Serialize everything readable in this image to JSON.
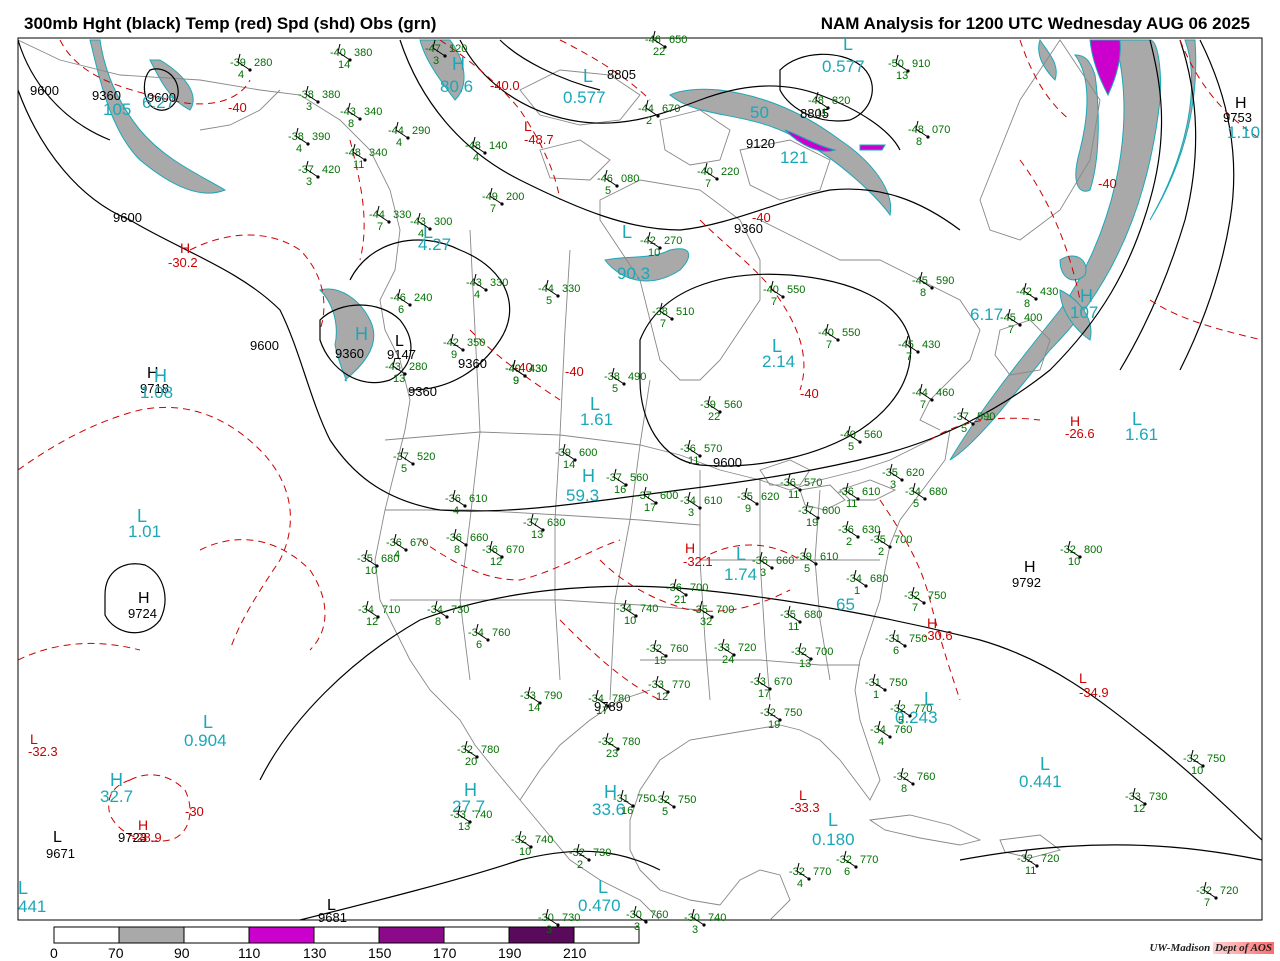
{
  "header": {
    "left_title": "300mb Hght (black) Temp (red) Spd (shd) Obs (grn)",
    "right_title": "NAM Analysis for 1200 UTC Wednesday  AUG 06 2025"
  },
  "colors": {
    "height": "#000000",
    "temp": "#cc0000",
    "speed_label": "#1aa8b8",
    "obs": "#007000",
    "border": "#888888",
    "shade_70_90": "#a9a9a9",
    "shade_110_130": "#cc00cc",
    "shade_150_170": "#8a0a8a",
    "shade_190_210": "#5a0a5a"
  },
  "legend": {
    "ticks": [
      "0",
      "70",
      "90",
      "110",
      "130",
      "150",
      "170",
      "190",
      "210"
    ]
  },
  "credit": {
    "left": "UW-Madison",
    "right": "Dept of AOS"
  },
  "height_labels": [
    "9600",
    "9360",
    "9600",
    "9600",
    "9360",
    "9147",
    "9360",
    "9360",
    "9600",
    "9792",
    "9724",
    "9718",
    "9671",
    "9723",
    "9681",
    "9789",
    "9753",
    "8805",
    "8805",
    "9120",
    "9360",
    "9600"
  ],
  "height_centers": [
    {
      "letter": "H",
      "value": "9718"
    },
    {
      "letter": "H",
      "value": "9724"
    },
    {
      "letter": "H",
      "value": "9792"
    },
    {
      "letter": "H",
      "value": "9753"
    },
    {
      "letter": "L",
      "value": "9671"
    },
    {
      "letter": "L",
      "value": "9681"
    },
    {
      "letter": "L",
      "value": "9147"
    }
  ],
  "temp_labels": [
    "-30.2",
    "-40",
    "-40.0",
    "-40",
    "-40",
    "-48.7",
    "-40",
    "-40",
    "-32.1",
    "-26.6",
    "-30.6",
    "-34.9",
    "-32.3",
    "-30",
    "-33.3",
    "-28.9",
    "-40"
  ],
  "speed_labels": [
    "105",
    "6.27",
    "80.6",
    "0.577",
    "0.577",
    "4.27",
    "90.3",
    "2.14",
    "1.61",
    "1.61",
    "59.3",
    "1.01",
    "0.904",
    "32.7",
    "27.7",
    "33.6",
    "0.180",
    "0.470",
    "0.441",
    "0.243",
    "1.10",
    "107",
    "6.17",
    "1.08",
    "65",
    "1.74",
    "441",
    "121",
    "50"
  ],
  "station_obs": [
    {
      "t": "-39",
      "h": "280",
      "s": "4"
    },
    {
      "t": "-40",
      "h": "380",
      "s": "14"
    },
    {
      "t": "-47",
      "h": "120",
      "s": "3"
    },
    {
      "t": "-38",
      "h": "380",
      "s": "3"
    },
    {
      "t": "-43",
      "h": "340",
      "s": "8"
    },
    {
      "t": "-38",
      "h": "390",
      "s": "4"
    },
    {
      "t": "-44",
      "h": "290",
      "s": "4"
    },
    {
      "t": "-48",
      "h": "340",
      "s": "11"
    },
    {
      "t": "-37",
      "h": "420",
      "s": "3"
    },
    {
      "t": "-48",
      "h": "140",
      "s": "4"
    },
    {
      "t": "-46",
      "h": "080",
      "s": "5"
    },
    {
      "t": "-49",
      "h": "200",
      "s": "7"
    },
    {
      "t": "-44",
      "h": "670",
      "s": "2"
    },
    {
      "t": "-46",
      "h": "650",
      "s": "22"
    },
    {
      "t": "-40",
      "h": "220",
      "s": "7"
    },
    {
      "t": "-50",
      "h": "910",
      "s": "13"
    },
    {
      "t": "-48",
      "h": "820",
      "s": "11"
    },
    {
      "t": "-48",
      "h": "070",
      "s": "8"
    },
    {
      "t": "-44",
      "h": "330",
      "s": "7"
    },
    {
      "t": "-43",
      "h": "300",
      "s": "4"
    },
    {
      "t": "-42",
      "h": "270",
      "s": "10"
    },
    {
      "t": "-46",
      "h": "240",
      "s": "6"
    },
    {
      "t": "-43",
      "h": "330",
      "s": "4"
    },
    {
      "t": "-44",
      "h": "330",
      "s": "5"
    },
    {
      "t": "-42",
      "h": "350",
      "s": "9"
    },
    {
      "t": "-40",
      "h": "430",
      "s": "9"
    },
    {
      "t": "-43",
      "h": "280",
      "s": "13"
    },
    {
      "t": "-38",
      "h": "510",
      "s": "7"
    },
    {
      "t": "-40",
      "h": "550",
      "s": "7"
    },
    {
      "t": "-40",
      "h": "550",
      "s": "7"
    },
    {
      "t": "-45",
      "h": "590",
      "s": "8"
    },
    {
      "t": "-45",
      "h": "430",
      "s": "7"
    },
    {
      "t": "-42",
      "h": "430",
      "s": "8"
    },
    {
      "t": "-45",
      "h": "400",
      "s": "7"
    },
    {
      "t": "-38",
      "h": "490",
      "s": "5"
    },
    {
      "t": "-40",
      "h": "430",
      "s": "9"
    },
    {
      "t": "-39",
      "h": "560",
      "s": "22"
    },
    {
      "t": "-44",
      "h": "460",
      "s": "7"
    },
    {
      "t": "-37",
      "h": "590",
      "s": "5"
    },
    {
      "t": "-37",
      "h": "520",
      "s": "5"
    },
    {
      "t": "-39",
      "h": "600",
      "s": "14"
    },
    {
      "t": "-36",
      "h": "570",
      "s": "11"
    },
    {
      "t": "-40",
      "h": "560",
      "s": "5"
    },
    {
      "t": "-37",
      "h": "560",
      "s": "16"
    },
    {
      "t": "-36",
      "h": "610",
      "s": "4"
    },
    {
      "t": "-37",
      "h": "600",
      "s": "17"
    },
    {
      "t": "-34",
      "h": "610",
      "s": "3"
    },
    {
      "t": "-35",
      "h": "620",
      "s": "9"
    },
    {
      "t": "-36",
      "h": "570",
      "s": "11"
    },
    {
      "t": "-35",
      "h": "620",
      "s": "3"
    },
    {
      "t": "-34",
      "h": "680",
      "s": "5"
    },
    {
      "t": "-36",
      "h": "610",
      "s": "11"
    },
    {
      "t": "-37",
      "h": "600",
      "s": "19"
    },
    {
      "t": "-36",
      "h": "630",
      "s": "2"
    },
    {
      "t": "-35",
      "h": "700",
      "s": "2"
    },
    {
      "t": "-32",
      "h": "800",
      "s": "10"
    },
    {
      "t": "-37",
      "h": "630",
      "s": "13"
    },
    {
      "t": "-36",
      "h": "670",
      "s": "4"
    },
    {
      "t": "-36",
      "h": "660",
      "s": "8"
    },
    {
      "t": "-36",
      "h": "670",
      "s": "12"
    },
    {
      "t": "-35",
      "h": "680",
      "s": "10"
    },
    {
      "t": "-34",
      "h": "710",
      "s": "12"
    },
    {
      "t": "-34",
      "h": "730",
      "s": "8"
    },
    {
      "t": "-34",
      "h": "760",
      "s": "6"
    },
    {
      "t": "-36",
      "h": "660",
      "s": "3"
    },
    {
      "t": "-39",
      "h": "610",
      "s": "5"
    },
    {
      "t": "-34",
      "h": "680",
      "s": "1"
    },
    {
      "t": "-32",
      "h": "750",
      "s": "7"
    },
    {
      "t": "-36",
      "h": "700",
      "s": "21"
    },
    {
      "t": "-35",
      "h": "700",
      "s": "32"
    },
    {
      "t": "-34",
      "h": "740",
      "s": "10"
    },
    {
      "t": "-35",
      "h": "680",
      "s": "11"
    },
    {
      "t": "-33",
      "h": "720",
      "s": "24"
    },
    {
      "t": "-32",
      "h": "700",
      "s": "13"
    },
    {
      "t": "-31",
      "h": "750",
      "s": "6"
    },
    {
      "t": "-32",
      "h": "760",
      "s": "15"
    },
    {
      "t": "-33",
      "h": "770",
      "s": "12"
    },
    {
      "t": "-33",
      "h": "670",
      "s": "17"
    },
    {
      "t": "-33",
      "h": "790",
      "s": "14"
    },
    {
      "t": "-34",
      "h": "780",
      "s": "17"
    },
    {
      "t": "-31",
      "h": "750",
      "s": "1"
    },
    {
      "t": "-32",
      "h": "750",
      "s": "19"
    },
    {
      "t": "-32",
      "h": "770",
      "s": "5"
    },
    {
      "t": "-32",
      "h": "780",
      "s": "23"
    },
    {
      "t": "-34",
      "h": "760",
      "s": "4"
    },
    {
      "t": "-32",
      "h": "780",
      "s": "20"
    },
    {
      "t": "-33",
      "h": "740",
      "s": "13"
    },
    {
      "t": "-31",
      "h": "750",
      "s": "16"
    },
    {
      "t": "-32",
      "h": "750",
      "s": "5"
    },
    {
      "t": "-32",
      "h": "760",
      "s": "8"
    },
    {
      "t": "-32",
      "h": "740",
      "s": "10"
    },
    {
      "t": "-32",
      "h": "730",
      "s": "2"
    },
    {
      "t": "-32",
      "h": "770",
      "s": "6"
    },
    {
      "t": "-32",
      "h": "770",
      "s": "4"
    },
    {
      "t": "-30",
      "h": "730",
      "s": "3"
    },
    {
      "t": "-30",
      "h": "760",
      "s": "3"
    },
    {
      "t": "-30",
      "h": "740",
      "s": "3"
    },
    {
      "t": "-32",
      "h": "720",
      "s": "11"
    },
    {
      "t": "-32",
      "h": "750",
      "s": "10"
    },
    {
      "t": "-33",
      "h": "730",
      "s": "12"
    },
    {
      "t": "-32",
      "h": "720",
      "s": "7"
    }
  ]
}
